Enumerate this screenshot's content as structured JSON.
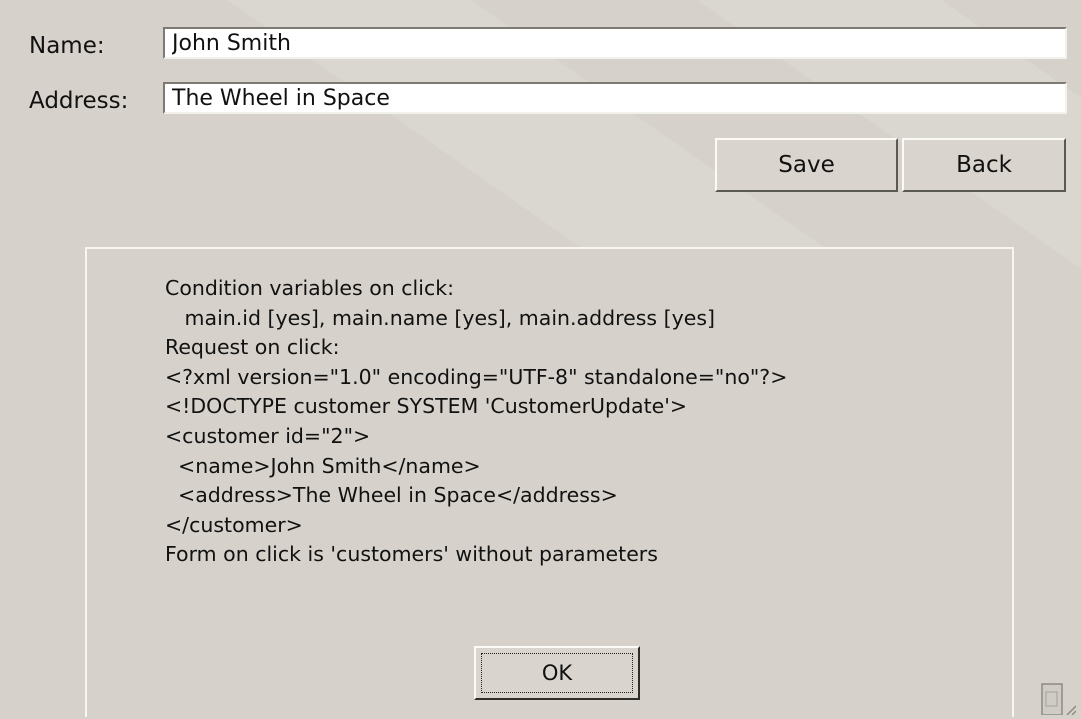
{
  "form": {
    "name_label": "Name:",
    "name_value": "John Smith",
    "address_label": "Address:",
    "address_value": "The Wheel in Space",
    "save_label": "Save",
    "back_label": "Back"
  },
  "dialog": {
    "message_lines": [
      "Condition variables on click:",
      "   main.id [yes], main.name [yes], main.address [yes]",
      "Request on click:",
      "<?xml version=\"1.0\" encoding=\"UTF-8\" standalone=\"no\"?>",
      "<!DOCTYPE customer SYSTEM 'CustomerUpdate'>",
      "<customer id=\"2\">",
      "  <name>John Smith</name>",
      "  <address>The Wheel in Space</address>",
      "</customer>",
      "Form on click is 'customers' without parameters"
    ],
    "ok_label": "OK"
  },
  "icons": {
    "corner": "resize-grip-icon"
  }
}
